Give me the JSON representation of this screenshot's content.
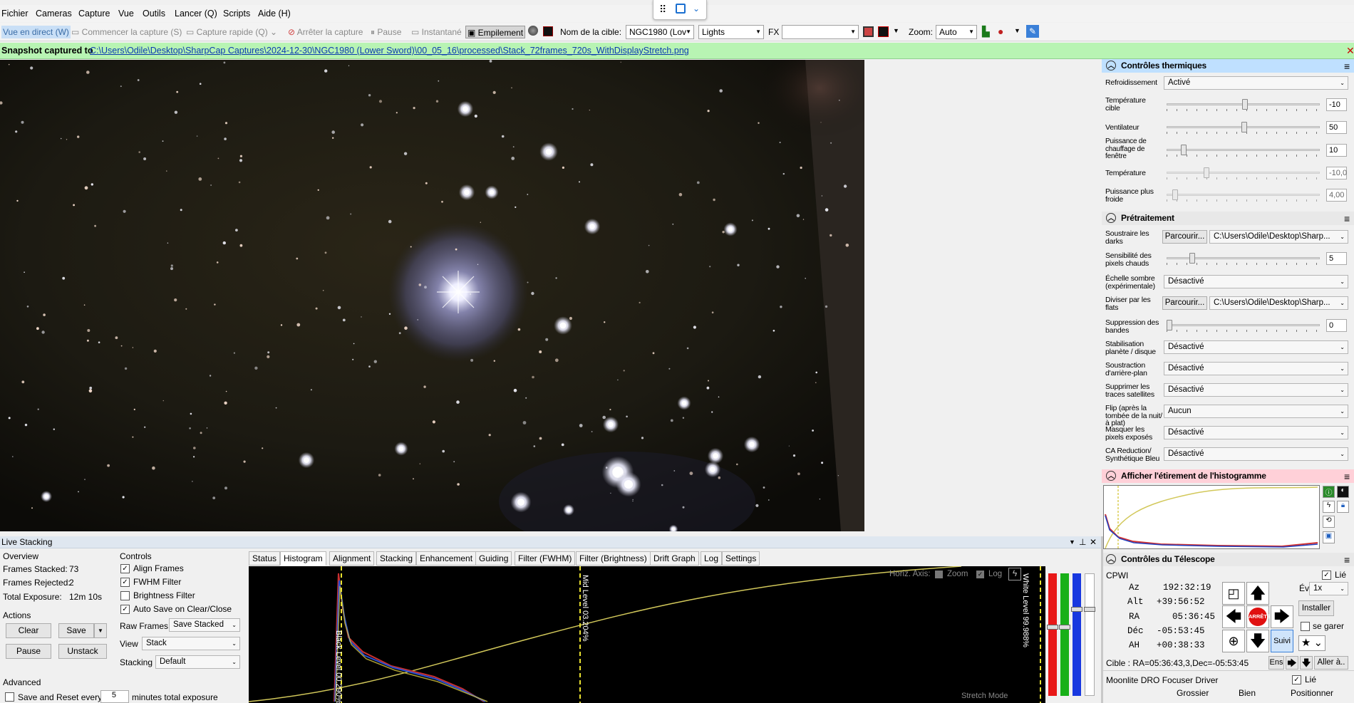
{
  "menu": [
    "Fichier",
    "Cameras",
    "Capture",
    "Vue",
    "Outils",
    "Lancer (Q)",
    "Scripts",
    "Aide (H)"
  ],
  "toolbar": {
    "live_view": "Vue en direct (W)",
    "start_capture": "Commencer la capture (S)",
    "quick_capture": "Capture rapide (Q)",
    "stop_capture": "Arrêter la capture",
    "pause": "Pause",
    "snapshot": "Instantané",
    "stacking": "Empilement",
    "target_label": "Nom de la cible:",
    "target_value": "NGC1980 (Lov",
    "frame_type": "Lights",
    "fx_label": "FX",
    "zoom_label": "Zoom:",
    "zoom_value": "Auto"
  },
  "status": {
    "prefix": "Snapshot captured to",
    "path": "C:\\Users\\Odile\\Desktop\\SharpCap Captures\\2024-12-30\\NGC1980 (Lower Sword)\\00_05_16\\processed\\Stack_72frames_720s_WithDisplayStretch.png"
  },
  "thermal": {
    "title": "Contrôles thermiques",
    "rows": [
      {
        "label": "Refroidissement",
        "value": "Activé"
      },
      {
        "label": "Température cible",
        "value": "-10"
      },
      {
        "label": "Ventilateur",
        "value": "50"
      },
      {
        "label": "Puissance de chauffage de fenêtre",
        "value": "10"
      },
      {
        "label": "Température",
        "value": "-10,0"
      },
      {
        "label": "Puissance plus froide",
        "value": "4,00"
      }
    ]
  },
  "preproc": {
    "title": "Prétraitement",
    "rows": [
      {
        "label": "Soustraire les darks",
        "button": "Parcourir...",
        "value": "C:\\Users\\Odile\\Desktop\\Sharp..."
      },
      {
        "label": "Sensibilité des pixels chauds",
        "value": "5"
      },
      {
        "label": "Échelle sombre (expérimentale)",
        "value": "Désactivé"
      },
      {
        "label": "Diviser par les flats",
        "button": "Parcourir...",
        "value": "C:\\Users\\Odile\\Desktop\\Sharp..."
      },
      {
        "label": "Suppression des bandes",
        "value": "0"
      },
      {
        "label": "Stabilisation planète / disque",
        "value": "Désactivé"
      },
      {
        "label": "Soustraction d'arrière-plan",
        "value": "Désactivé"
      },
      {
        "label": "Supprimer les traces satellites",
        "value": "Désactivé"
      },
      {
        "label": "Flip (après la tombée de la nuit/à plat)",
        "value": "Aucun"
      },
      {
        "label": "Masquer les pixels exposés",
        "value": "Désactivé"
      },
      {
        "label": "CA Reduction/ Synthétique Bleu",
        "value": "Désactivé"
      }
    ]
  },
  "histstretch": {
    "title": "Afficher l'étirement de l'histogramme"
  },
  "telescope": {
    "title": "Contrôles du Télescope",
    "mount": "CPWI",
    "linked": "Lié",
    "az_label": "Az",
    "az": "192:32:19",
    "alt_label": "Alt",
    "alt": "+39:56:52",
    "ra_label": "RA",
    "ra": "05:36:45",
    "dec_label": "Déc",
    "dec": "-05:53:45",
    "ah_label": "AH",
    "ah": "+00:38:33",
    "rate_label": "Évaluer:",
    "rate": "1x",
    "install": "Installer",
    "park": "se garer",
    "stop": "ARRÊTE",
    "track": "Suivi",
    "target": "Cible : RA=05:36:43,3,Dec=-05:53:45",
    "ens": "Ens",
    "goto": "Aller à..",
    "focuser": "Moonlite DRO Focuser Driver",
    "focuser_linked": "Lié",
    "coarse": "Grossier",
    "fine": "Bien",
    "position": "Positionner"
  },
  "live": {
    "title": "Live Stacking",
    "overview": "Overview",
    "stacked_label": "Frames Stacked:",
    "stacked": "73",
    "rejected_label": "Frames Rejected:",
    "rejected": "2",
    "exposure_label": "Total Exposure:",
    "exposure": "12m 10s",
    "actions": "Actions",
    "clear": "Clear",
    "save": "Save",
    "pause": "Pause",
    "unstack": "Unstack",
    "advanced": "Advanced",
    "save_reset": "Save and Reset every",
    "save_reset_value": "5",
    "save_reset_unit": "minutes total exposure",
    "controls": "Controls",
    "align": "Align Frames",
    "fwhm": "FWHM Filter",
    "brightness": "Brightness Filter",
    "autosave": "Auto Save on Clear/Close",
    "raw_label": "Raw Frames",
    "raw_value": "Save Stacked",
    "view_label": "View",
    "view_value": "Stack",
    "stacking_label": "Stacking",
    "stacking_value": "Default"
  },
  "tabs": [
    "Status",
    "Histogram",
    "Alignment",
    "Stacking",
    "Enhancement",
    "Guiding",
    "Filter (FWHM)",
    "Filter (Brightness)",
    "Drift Graph",
    "Log",
    "Settings"
  ],
  "histogram": {
    "horiz_axis": "Horiz. Axis:",
    "zoom": "Zoom",
    "log": "Log",
    "black": "Black Level 00.290%",
    "mid": "Mid Level 03.204%",
    "white": "White Level 99.988%",
    "stretch": "Stretch Mode"
  }
}
